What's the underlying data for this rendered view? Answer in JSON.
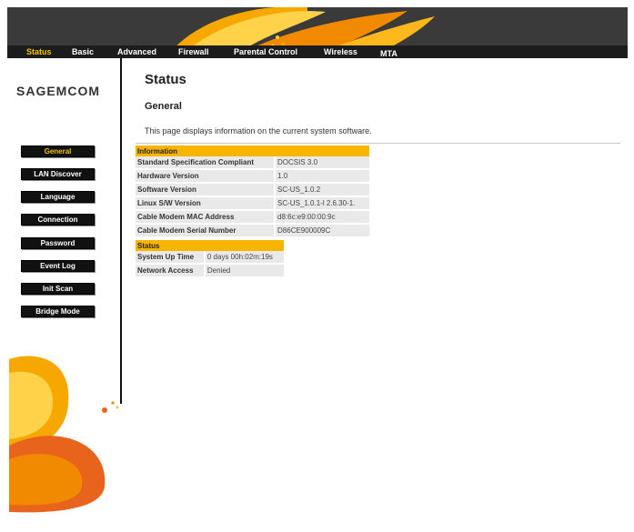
{
  "nav": {
    "items": [
      {
        "label": "Status",
        "active": true
      },
      {
        "label": "Basic",
        "active": false
      },
      {
        "label": "Advanced",
        "active": false
      },
      {
        "label": "Firewall",
        "active": false
      },
      {
        "label": "Parental Control",
        "active": false
      },
      {
        "label": "Wireless",
        "active": false
      },
      {
        "label": "MTA",
        "active": false
      }
    ]
  },
  "brand": {
    "logo": "SAGEMCOM"
  },
  "sidebar": {
    "items": [
      {
        "label": "General",
        "active": true
      },
      {
        "label": "LAN Discover",
        "active": false
      },
      {
        "label": "Language",
        "active": false
      },
      {
        "label": "Connection",
        "active": false
      },
      {
        "label": "Password",
        "active": false
      },
      {
        "label": "Event Log",
        "active": false
      },
      {
        "label": "Init Scan",
        "active": false
      },
      {
        "label": "Bridge Mode",
        "active": false
      }
    ]
  },
  "main": {
    "title": "Status",
    "section": "General",
    "description": "This page displays information on the current system software.",
    "information": {
      "header": "Information",
      "rows": [
        {
          "label": "Standard Specification Compliant",
          "value": "DOCSIS 3.0"
        },
        {
          "label": "Hardware Version",
          "value": "1.0"
        },
        {
          "label": "Software Version",
          "value": "SC-US_1.0.2"
        },
        {
          "label": "Linux S/W Version",
          "value": "SC-US_1.0.1-l 2.6.30-1."
        },
        {
          "label": "Cable Modem MAC Address",
          "value": "d8:6c:e9:00:00:9c"
        },
        {
          "label": "Cable Modem Serial Number",
          "value": "D86CE900009C"
        }
      ]
    },
    "status": {
      "header": "Status",
      "rows": [
        {
          "label": "System Up Time",
          "value": "0 days 00h:02m:19s"
        },
        {
          "label": "Network Access",
          "value": "Denied"
        }
      ]
    }
  },
  "colors": {
    "accent": "#f7b500",
    "banner": "#3a3a3a",
    "navbar": "#1c1c1c"
  }
}
